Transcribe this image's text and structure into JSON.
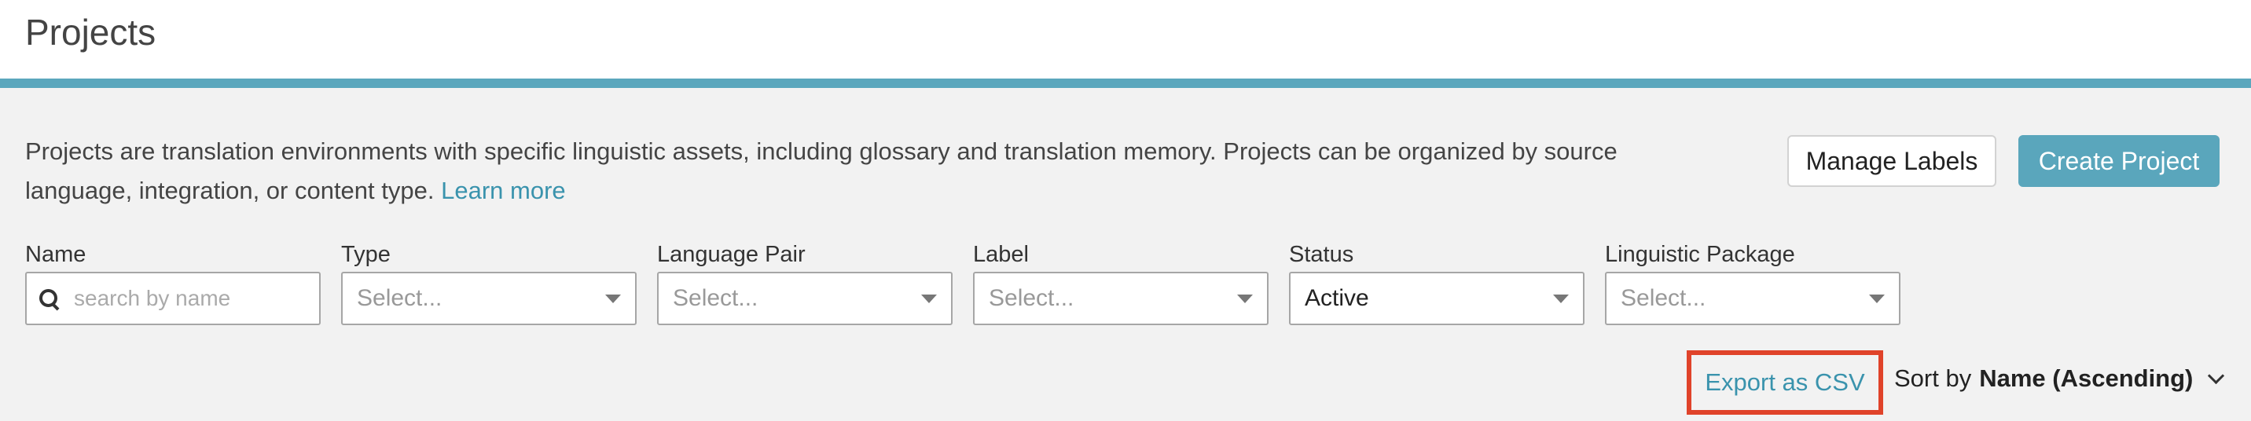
{
  "header": {
    "title": "Projects"
  },
  "intro": {
    "text": "Projects are translation environments with specific linguistic assets, including glossary and translation memory. Projects can be organized by source language, integration, or content type.",
    "learn_more": "Learn more"
  },
  "actions": {
    "manage_labels": "Manage Labels",
    "create_project": "Create Project"
  },
  "filters": {
    "name": {
      "label": "Name",
      "placeholder": "search by name"
    },
    "type": {
      "label": "Type",
      "value": "Select..."
    },
    "language_pair": {
      "label": "Language Pair",
      "value": "Select..."
    },
    "label": {
      "label": "Label",
      "value": "Select..."
    },
    "status": {
      "label": "Status",
      "value": "Active"
    },
    "linguistic_package": {
      "label": "Linguistic Package",
      "value": "Select..."
    }
  },
  "toolbar": {
    "export": "Export as CSV",
    "sort_prefix": "Sort by",
    "sort_value": "Name (Ascending)"
  },
  "icons": {
    "search": "search-icon",
    "caret": "caret-down-icon",
    "sort_chevron": "chevron-down-icon"
  },
  "colors": {
    "accent": "#5aa6bc",
    "link": "#3a93ad",
    "highlight": "#e0432a",
    "background": "#f2f2f2"
  }
}
